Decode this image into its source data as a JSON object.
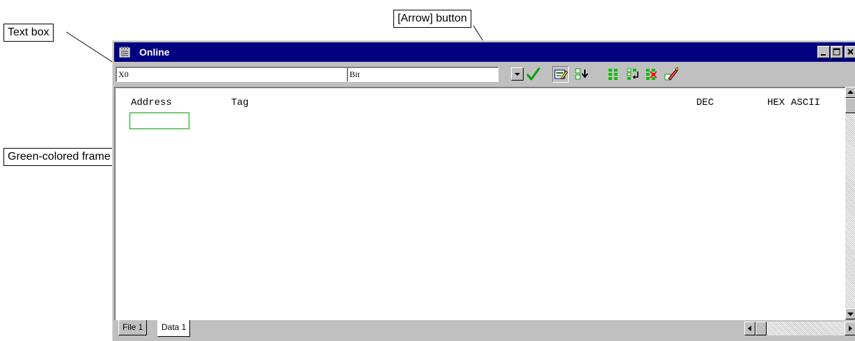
{
  "callouts": {
    "text_box": "Text box",
    "arrow_button": "[Arrow] button",
    "green_frame": "Green-colored frame"
  },
  "window": {
    "title": "Online"
  },
  "toolbar": {
    "address_value": "X0",
    "type_value": "Bit"
  },
  "table": {
    "headers": {
      "address": "Address",
      "tag": "Tag",
      "dec": "DEC",
      "hex": "HEX",
      "ascii": "ASCII"
    }
  },
  "tabs": [
    {
      "label": "File 1"
    },
    {
      "label": "Data 1"
    }
  ],
  "colors": {
    "titlebar": "#000080",
    "frame_green": "#00a000",
    "face": "#c0c0c0"
  }
}
